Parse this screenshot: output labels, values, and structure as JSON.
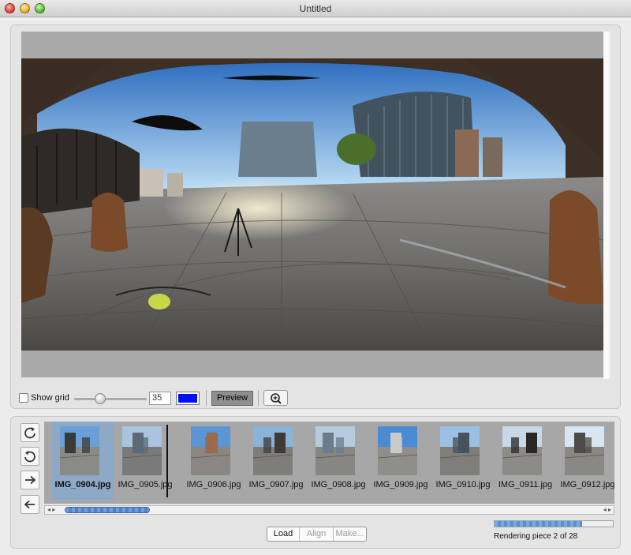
{
  "window": {
    "title": "Untitled"
  },
  "controls": {
    "show_grid_label": "Show grid",
    "show_grid_checked": false,
    "grid_value": "35",
    "grid_color": "#0010ff",
    "preview_label": "Preview"
  },
  "thumbnails": [
    {
      "name": "IMG_0904.jpg",
      "selected": true
    },
    {
      "name": "IMG_0905.jpg",
      "selected": false
    },
    {
      "name": "IMG_0906.jpg",
      "selected": false
    },
    {
      "name": "IMG_0907.jpg",
      "selected": false
    },
    {
      "name": "IMG_0908.jpg",
      "selected": false
    },
    {
      "name": "IMG_0909.jpg",
      "selected": false
    },
    {
      "name": "IMG_0910.jpg",
      "selected": false
    },
    {
      "name": "IMG_0911.jpg",
      "selected": false
    },
    {
      "name": "IMG_0912.jpg",
      "selected": false
    }
  ],
  "actions": {
    "load": "Load",
    "align": "Align",
    "make": "Make..."
  },
  "render": {
    "status": "Rendering piece 2 of 28",
    "progress_fraction": 0.74
  },
  "colors": {
    "canvas_bg": "#a9a9a9",
    "strip_bg": "#a7a7a7",
    "selected": "#8ea9c7",
    "accent": "#4f82c6"
  }
}
